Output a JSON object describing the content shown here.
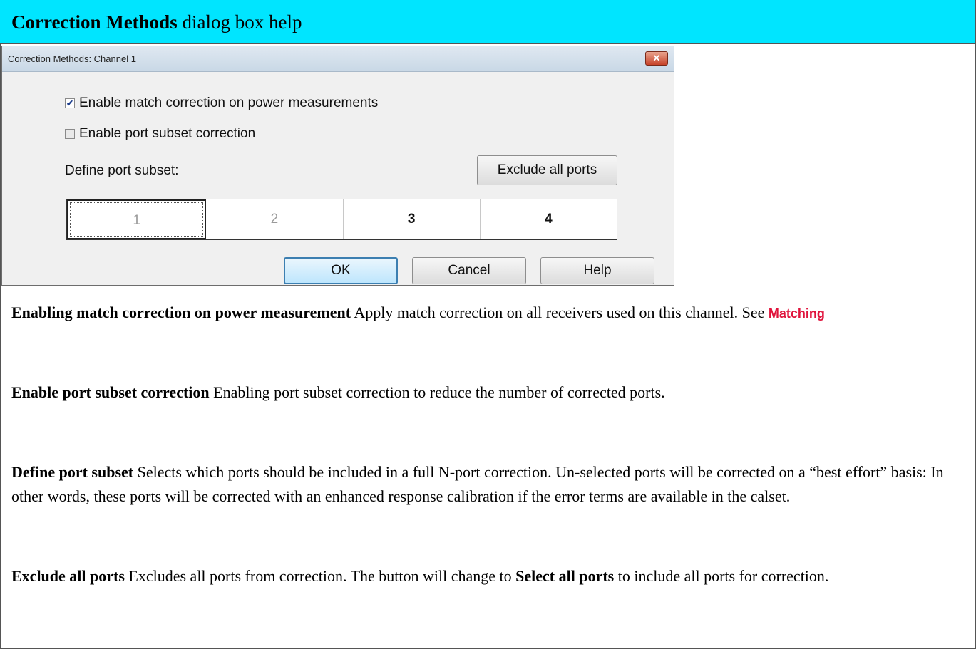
{
  "header": {
    "bold_title": "Correction Methods",
    "rest_title": " dialog box help"
  },
  "dialog": {
    "title": "Correction Methods: Channel 1",
    "close_glyph": "✕",
    "checkbox_match": {
      "label": "Enable match correction on power measurements",
      "checked": true
    },
    "checkbox_subset": {
      "label": "Enable port subset correction",
      "checked": false
    },
    "define_label": "Define port subset:",
    "exclude_button": "Exclude all ports",
    "ports": [
      "1",
      "2",
      "3",
      "4"
    ],
    "ok_button": "OK",
    "cancel_button": "Cancel",
    "help_button": "Help"
  },
  "help": {
    "p1_term": "Enabling match correction on power measurement",
    "p1_text": "  Apply match correction on all receivers used on this channel.  See ",
    "p1_link": "Matching",
    "p2_term": "Enable port subset correction",
    "p2_text": "  Enabling port subset correction to reduce the number of corrected ports.",
    "p3_term": "Define port subset",
    "p3_text": "  Selects which ports should be included in a full N-port correction. Un-selected ports will be corrected on a “best effort” basis: In other words, these ports will be corrected with an enhanced response calibration if the error terms are available in the calset.",
    "p4_term": "Exclude all ports",
    "p4_text_a": "  Excludes all ports from correction. The button will change to ",
    "p4_bold": "Select all ports",
    "p4_text_b": " to include all ports for correction."
  }
}
